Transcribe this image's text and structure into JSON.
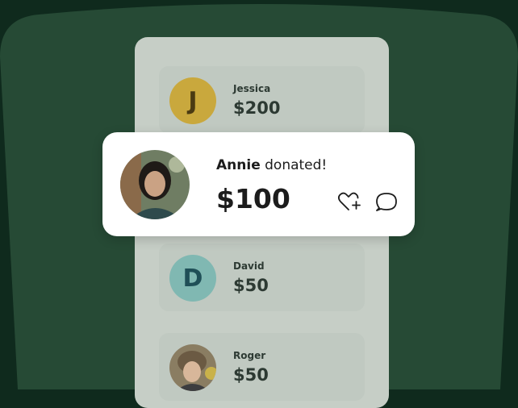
{
  "colors": {
    "background": "#0f2a1d",
    "backdrop": "#264a35",
    "phone": "#c6cec6",
    "card": "#c0c9c1"
  },
  "feed": [
    {
      "name": "Jessica",
      "amount": "$200",
      "avatar": "initial",
      "initial": "J",
      "avatar_color": "#c9a83d",
      "initial_color": "#4a3a12"
    },
    {
      "name": "David",
      "amount": "$50",
      "avatar": "initial",
      "initial": "D",
      "avatar_color": "#80b8b2",
      "initial_color": "#1f4f57"
    },
    {
      "name": "Roger",
      "amount": "$50",
      "avatar": "photo"
    }
  ],
  "highlight": {
    "name": "Annie",
    "action": "donated!",
    "amount": "$100",
    "avatar": "photo",
    "icons": [
      "heart-plus-icon",
      "comment-icon"
    ]
  }
}
